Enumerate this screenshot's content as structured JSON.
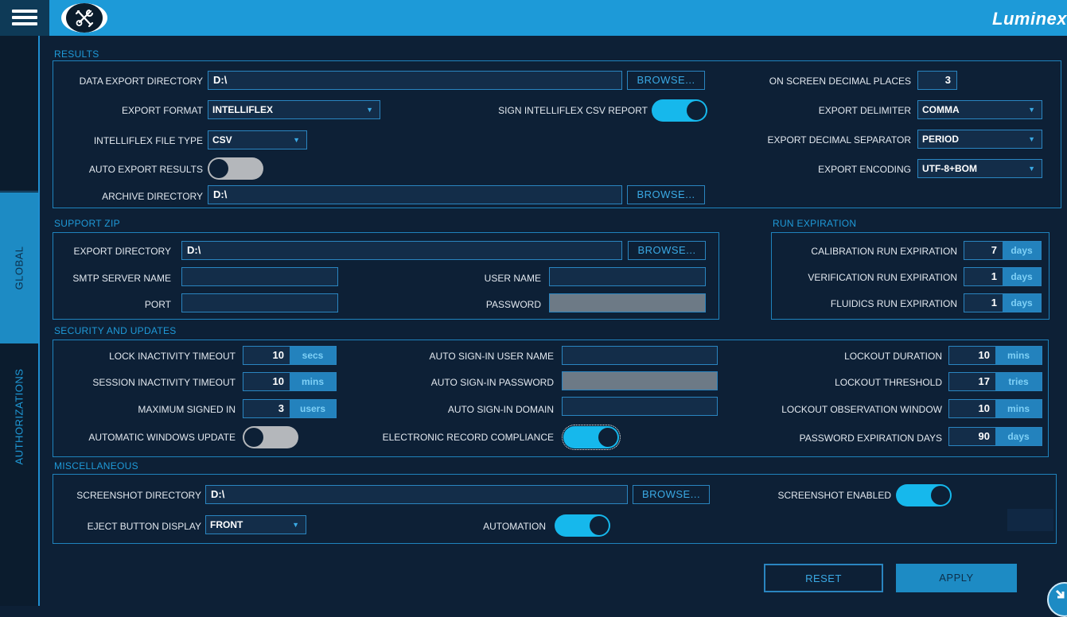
{
  "app": {
    "brand": "Luminex"
  },
  "icons": {
    "menu": "hamburger-menu-icon",
    "tools": "tools-icon",
    "corner": "scroll-down-icon"
  },
  "colors": {
    "accent": "#1d9ad8",
    "background": "#0d2036",
    "toggle_on": "#16b8ec",
    "toggle_off": "#b4b7bb"
  },
  "sidebar": {
    "tabs": [
      {
        "label": "",
        "active": false
      },
      {
        "label": "GLOBAL",
        "active": true
      },
      {
        "label": "AUTHORIZATIONS",
        "active": false
      }
    ]
  },
  "results": {
    "title": "RESULTS",
    "data_export_directory": {
      "label": "DATA EXPORT DIRECTORY",
      "value": "D:\\",
      "browse": "BROWSE..."
    },
    "export_format": {
      "label": "EXPORT FORMAT",
      "value": "INTELLIFLEX"
    },
    "intelliflex_file_type": {
      "label": "INTELLIFLEX FILE TYPE",
      "value": "CSV"
    },
    "auto_export_results": {
      "label": "AUTO EXPORT RESULTS",
      "on": false
    },
    "archive_directory": {
      "label": "ARCHIVE DIRECTORY",
      "value": "D:\\",
      "browse": "BROWSE..."
    },
    "sign_intelliflex_csv_report": {
      "label": "SIGN INTELLIFLEX CSV REPORT",
      "on": true
    },
    "on_screen_decimal_places": {
      "label": "ON SCREEN DECIMAL PLACES",
      "value": "3"
    },
    "export_delimiter": {
      "label": "EXPORT DELIMITER",
      "value": "COMMA"
    },
    "export_decimal_separator": {
      "label": "EXPORT DECIMAL SEPARATOR",
      "value": "PERIOD"
    },
    "export_encoding": {
      "label": "EXPORT ENCODING",
      "value": "UTF-8+BOM"
    }
  },
  "support_zip": {
    "title": "SUPPORT ZIP",
    "export_directory": {
      "label": "EXPORT DIRECTORY",
      "value": "D:\\",
      "browse": "BROWSE..."
    },
    "smtp_server_name": {
      "label": "SMTP SERVER NAME",
      "value": ""
    },
    "port": {
      "label": "PORT",
      "value": ""
    },
    "user_name": {
      "label": "USER NAME",
      "value": ""
    },
    "password": {
      "label": "PASSWORD",
      "value": ""
    }
  },
  "run_expiration": {
    "title": "RUN EXPIRATION",
    "calibration": {
      "label": "CALIBRATION RUN EXPIRATION",
      "value": "7",
      "unit": "days"
    },
    "verification": {
      "label": "VERIFICATION RUN EXPIRATION",
      "value": "1",
      "unit": "days"
    },
    "fluidics": {
      "label": "FLUIDICS RUN EXPIRATION",
      "value": "1",
      "unit": "days"
    }
  },
  "security": {
    "title": "SECURITY AND UPDATES",
    "lock_inactivity_timeout": {
      "label": "LOCK INACTIVITY TIMEOUT",
      "value": "10",
      "unit": "secs"
    },
    "session_inactivity_timeout": {
      "label": "SESSION INACTIVITY TIMEOUT",
      "value": "10",
      "unit": "mins"
    },
    "maximum_signed_in": {
      "label": "MAXIMUM SIGNED IN",
      "value": "3",
      "unit": "users"
    },
    "automatic_windows_update": {
      "label": "AUTOMATIC WINDOWS UPDATE",
      "on": false
    },
    "auto_signin_user_name": {
      "label": "AUTO SIGN-IN USER NAME",
      "value": ""
    },
    "auto_signin_password": {
      "label": "AUTO SIGN-IN PASSWORD",
      "value": ""
    },
    "auto_signin_domain": {
      "label": "AUTO SIGN-IN DOMAIN",
      "value": ""
    },
    "electronic_record_compliance": {
      "label": "ELECTRONIC RECORD COMPLIANCE",
      "on": true
    },
    "lockout_duration": {
      "label": "LOCKOUT DURATION",
      "value": "10",
      "unit": "mins"
    },
    "lockout_threshold": {
      "label": "LOCKOUT THRESHOLD",
      "value": "17",
      "unit": "tries"
    },
    "lockout_observation_window": {
      "label": "LOCKOUT OBSERVATION WINDOW",
      "value": "10",
      "unit": "mins"
    },
    "password_expiration_days": {
      "label": "PASSWORD EXPIRATION DAYS",
      "value": "90",
      "unit": "days"
    }
  },
  "misc": {
    "title": "MISCELLANEOUS",
    "screenshot_directory": {
      "label": "SCREENSHOT DIRECTORY",
      "value": "D:\\",
      "browse": "BROWSE..."
    },
    "eject_button_display": {
      "label": "EJECT BUTTON DISPLAY",
      "value": "FRONT"
    },
    "screenshot_enabled": {
      "label": "SCREENSHOT ENABLED",
      "on": true
    },
    "automation": {
      "label": "AUTOMATION",
      "on": true
    }
  },
  "actions": {
    "reset": "RESET",
    "apply": "APPLY"
  }
}
